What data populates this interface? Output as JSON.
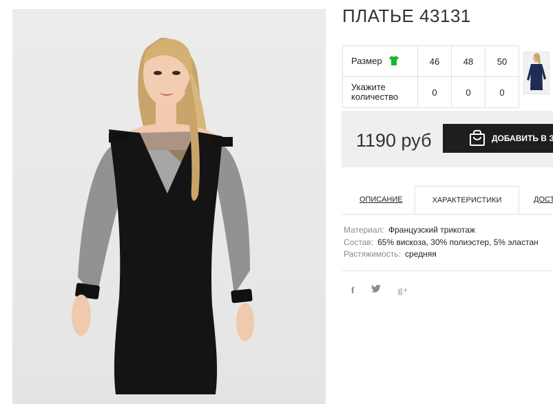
{
  "product": {
    "title": "ПЛАТЬЕ 43131",
    "image_alt_icon": "product-photo"
  },
  "size_table": {
    "size_label": "Размер",
    "size_icon": "tshirt-icon",
    "sizes": [
      "46",
      "48",
      "50"
    ],
    "qty_label_line1": "Укажите",
    "qty_label_line2": "количество",
    "quantities": [
      "0",
      "0",
      "0"
    ]
  },
  "price_bar": {
    "price": "1190 руб",
    "cart_button_label": "ДОБАВИТЬ В ЗАКАЗ",
    "cart_icon": "shopping-bag-icon"
  },
  "tabs": [
    {
      "label": "ОПИСАНИЕ",
      "active": false
    },
    {
      "label": "ХАРАКТЕРИСТИКИ",
      "active": true
    },
    {
      "label": "ДОСТАВКА",
      "active": false
    }
  ],
  "specs": [
    {
      "key": "Материал:",
      "value": "Французский трикотаж"
    },
    {
      "key": "Состав:",
      "value": "65% вискоза, 30% полиэстер, 5% эластан"
    },
    {
      "key": "Растяжимость:",
      "value": "средняя"
    }
  ],
  "social": {
    "facebook": "f",
    "twitter": "🐦",
    "google_plus": "g+"
  },
  "colors": {
    "accent_green": "#19b832",
    "button_dark": "#1e1e1e",
    "price_bg": "#efefef"
  }
}
